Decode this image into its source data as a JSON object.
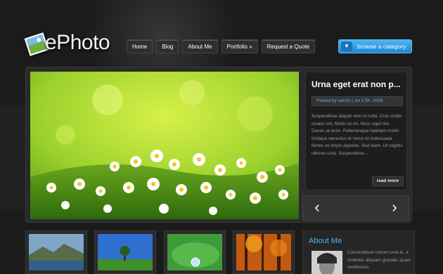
{
  "logo": {
    "text": "ePhoto"
  },
  "nav": {
    "items": [
      "Home",
      "Blog",
      "About Me",
      "Portfolio »",
      "Request a Quote"
    ]
  },
  "browse": {
    "label": "browse a category",
    "icon": "chevron-down-icon"
  },
  "featured": {
    "title": "Urna eget erat non p...",
    "meta": "Posted by admin | Jul 17th, 2008",
    "excerpt": "Suspendisse aliquet sem ut nulla. Cras mollis omare nisl. Morbi ac mi. Nunc eget nisi. Donec at enim. Pellentesque habitant morbi tristique senectus et netus et malesuada fames ac turpis egestas. Sed diam. Ut sagittis ultrices urna. Suspendisse...",
    "read_more": "read more",
    "prev": "‹",
    "next": "›"
  },
  "about": {
    "title": "About Me",
    "text": "Consectetuer rutrum urna in, a molestie aliquam gravida, quam vestibulum"
  },
  "colors": {
    "accent": "#4fb3f0",
    "background": "#1b1b1b"
  }
}
